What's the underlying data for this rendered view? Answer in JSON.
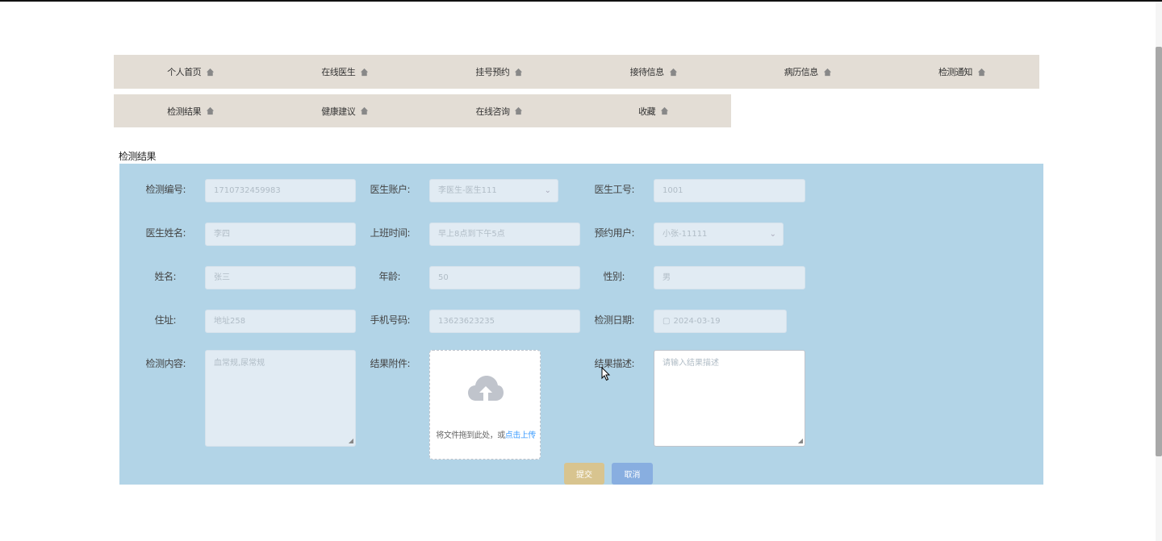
{
  "nav": {
    "row1": [
      "个人首页",
      "在线医生",
      "挂号预约",
      "接待信息",
      "病历信息",
      "检测通知"
    ],
    "row2": [
      "检测结果",
      "健康建议",
      "在线咨询",
      "收藏"
    ],
    "icon": "home-icon"
  },
  "section_title": "检测结果",
  "form": {
    "labels": {
      "test_no": "检测编号:",
      "doctor_account": "医生账户:",
      "doctor_id": "医生工号:",
      "doctor_name": "医生姓名:",
      "work_time": "上班时间:",
      "booking_user": "预约用户:",
      "name": "姓名:",
      "age": "年龄:",
      "gender": "性别:",
      "address": "住址:",
      "phone": "手机号码:",
      "test_date": "检测日期:",
      "test_content": "检测内容:",
      "attachment": "结果附件:",
      "description": "结果描述:"
    },
    "values": {
      "test_no": "1710732459983",
      "doctor_account": "李医生-医生111",
      "doctor_id": "1001",
      "doctor_name": "李四",
      "work_time": "早上8点到下午5点",
      "booking_user": "小张-11111",
      "name": "张三",
      "age": "50",
      "gender": "男",
      "address": "地址258",
      "phone": "13623623235",
      "test_date": "2024-03-19",
      "test_content": "血常规,尿常规"
    },
    "placeholders": {
      "description": "请输入结果描述"
    },
    "upload": {
      "hint": "将文件拖到此处，或",
      "link": "点击上传"
    },
    "buttons": {
      "submit": "提交",
      "cancel": "取消"
    }
  }
}
